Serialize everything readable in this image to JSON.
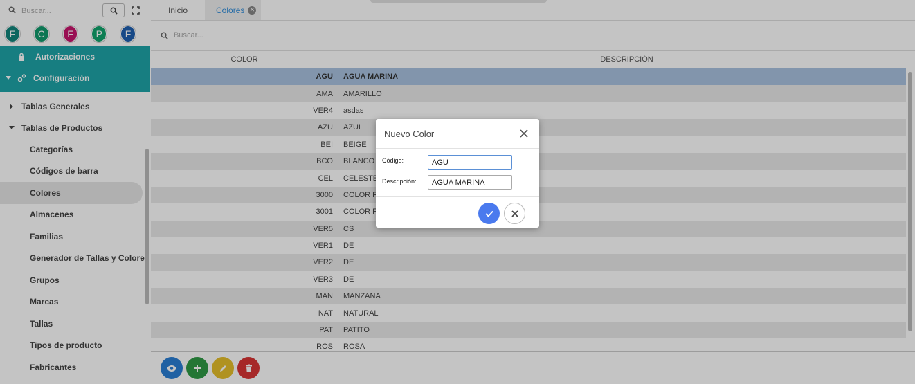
{
  "sidebar": {
    "search_placeholder": "Buscar...",
    "avatars": [
      {
        "letter": "F",
        "color": "#12857c"
      },
      {
        "letter": "C",
        "color": "#129a6d"
      },
      {
        "letter": "F",
        "color": "#c8166c"
      },
      {
        "letter": "P",
        "color": "#12a46d"
      },
      {
        "letter": "F",
        "color": "#1e5fb0"
      }
    ],
    "autorizaciones": "Autorizaciones",
    "configuracion": "Configuración",
    "tablas_generales": "Tablas Generales",
    "tablas_productos": "Tablas de Productos",
    "items": [
      "Categorías",
      "Códigos de barra",
      "Colores",
      "Almacenes",
      "Familias",
      "Generador de Tallas y Colores",
      "Grupos",
      "Marcas",
      "Tallas",
      "Tipos de producto",
      "Fabricantes"
    ],
    "active_item": "Colores"
  },
  "tabs": [
    {
      "label": "Inicio"
    },
    {
      "label": "Colores"
    }
  ],
  "search_placeholder": "Buscar...",
  "table": {
    "headers": {
      "color": "COLOR",
      "descripcion": "DESCRIPCIÓN"
    },
    "rows": [
      {
        "code": "AGU",
        "desc": "AGUA MARINA"
      },
      {
        "code": "AMA",
        "desc": "AMARILLO"
      },
      {
        "code": "VER4",
        "desc": "asdas"
      },
      {
        "code": "AZU",
        "desc": "AZUL"
      },
      {
        "code": "BEI",
        "desc": "BEIGE"
      },
      {
        "code": "BCO",
        "desc": "BLANCO"
      },
      {
        "code": "CEL",
        "desc": "CELESTE"
      },
      {
        "code": "3000",
        "desc": "COLOR FF"
      },
      {
        "code": "3001",
        "desc": "COLOR FF"
      },
      {
        "code": "VER5",
        "desc": "CS"
      },
      {
        "code": "VER1",
        "desc": "DE"
      },
      {
        "code": "VER2",
        "desc": "DE"
      },
      {
        "code": "VER3",
        "desc": "DE"
      },
      {
        "code": "MAN",
        "desc": "MANZANA"
      },
      {
        "code": "NAT",
        "desc": "NATURAL"
      },
      {
        "code": "PAT",
        "desc": "PATITO"
      },
      {
        "code": "ROS",
        "desc": "ROSA"
      }
    ]
  },
  "footer_buttons": [
    {
      "icon": "eye-icon",
      "color": "#2a7fd4"
    },
    {
      "icon": "plus-icon",
      "color": "#2f9a45"
    },
    {
      "icon": "pencil-icon",
      "color": "#e5bf2a"
    },
    {
      "icon": "trash-icon",
      "color": "#d93535"
    }
  ],
  "dialog": {
    "title": "Nuevo Color",
    "codigo_label": "Código:",
    "codigo_value": "AGU",
    "descripcion_label": "Descripción:",
    "descripcion_value": "AGUA MARINA"
  }
}
